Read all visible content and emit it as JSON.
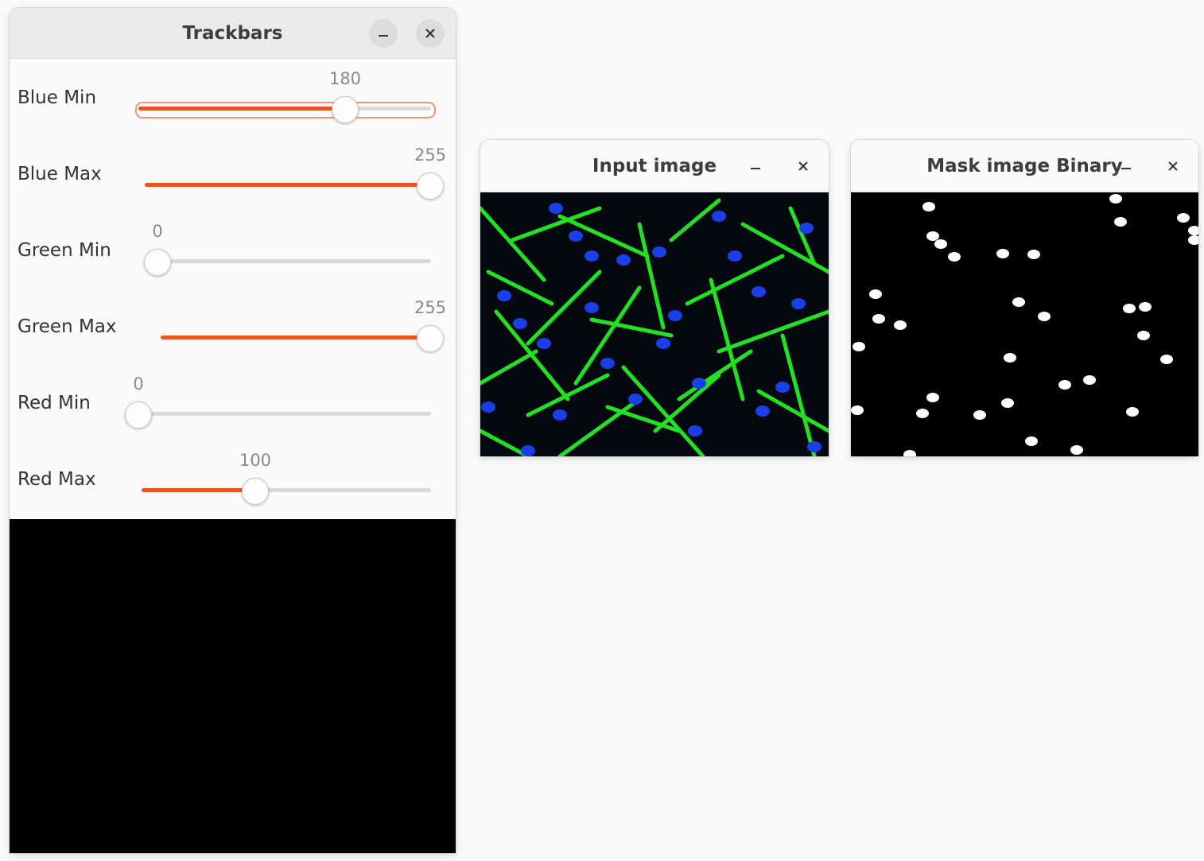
{
  "windows": {
    "trackbars": {
      "title": "Trackbars",
      "controls": [
        {
          "label": "Blue Min",
          "value": "180",
          "fraction": 0.706
        },
        {
          "label": "Blue Max",
          "value": "255",
          "fraction": 1.0
        },
        {
          "label": "Green Min",
          "value": "0",
          "fraction": 0.0
        },
        {
          "label": "Green Max",
          "value": "255",
          "fraction": 1.0
        },
        {
          "label": "Red Min",
          "value": "0",
          "fraction": 0.0
        },
        {
          "label": "Red Max",
          "value": "100",
          "fraction": 0.392
        }
      ]
    },
    "input": {
      "title": "Input image"
    },
    "mask": {
      "title": "Mask image Binary"
    }
  },
  "colors": {
    "accent": "#e95420",
    "cell_body": "#22e022",
    "nucleus": "#1a3fe8",
    "image_background": "#04080f"
  },
  "icons": {
    "minimize": "minimize-icon",
    "close": "close-icon"
  }
}
